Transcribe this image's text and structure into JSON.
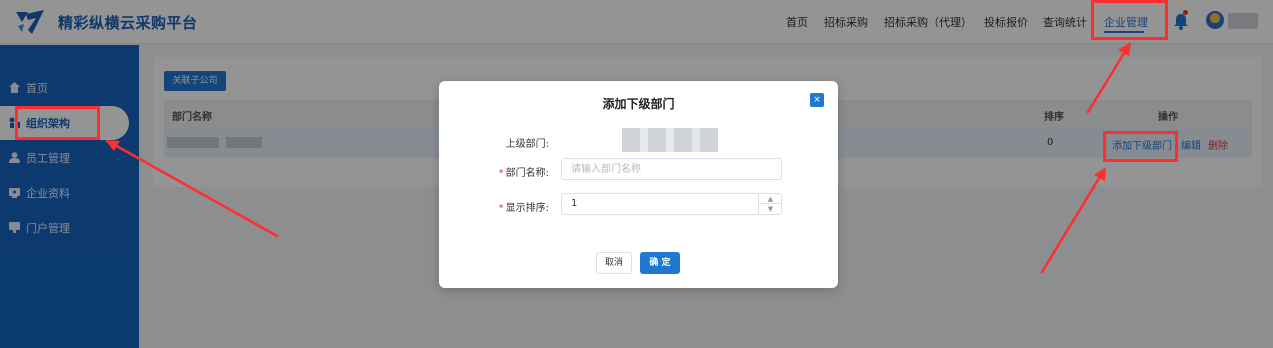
{
  "header": {
    "brand": "精彩纵横云采购平台",
    "nav": [
      "首页",
      "招标采购",
      "招标采购（代理）",
      "投标报价",
      "查询统计",
      "企业管理"
    ],
    "active_nav": "企业管理",
    "icons": [
      "logo-icon",
      "bell-icon",
      "avatar"
    ]
  },
  "sidebar": {
    "items": [
      {
        "label": "首页",
        "icon": "home-icon"
      },
      {
        "label": "组织架构",
        "icon": "org-icon",
        "active": true
      },
      {
        "label": "员工管理",
        "icon": "user-icon"
      },
      {
        "label": "企业资料",
        "icon": "profile-icon"
      },
      {
        "label": "门户管理",
        "icon": "portal-icon"
      }
    ]
  },
  "main": {
    "link_company_button": "关联子公司",
    "table": {
      "headers": {
        "name": "部门名称",
        "sort": "排序",
        "actions": "操作"
      },
      "rows": [
        {
          "sort": "0",
          "actions": {
            "add": "添加下级部门",
            "edit": "编辑",
            "delete": "删除"
          }
        }
      ]
    }
  },
  "modal": {
    "title": "添加下级部门",
    "close": "×",
    "parent_label": "上级部门:",
    "name_label": "部门名称:",
    "name_placeholder": "请输入部门名称",
    "sort_label": "显示排序:",
    "sort_value": "1",
    "cancel": "取消",
    "confirm": "确 定"
  },
  "colors": {
    "primary": "#1f78d1",
    "sidebar": "#1565c0",
    "annotation": "#ff2d2d"
  }
}
